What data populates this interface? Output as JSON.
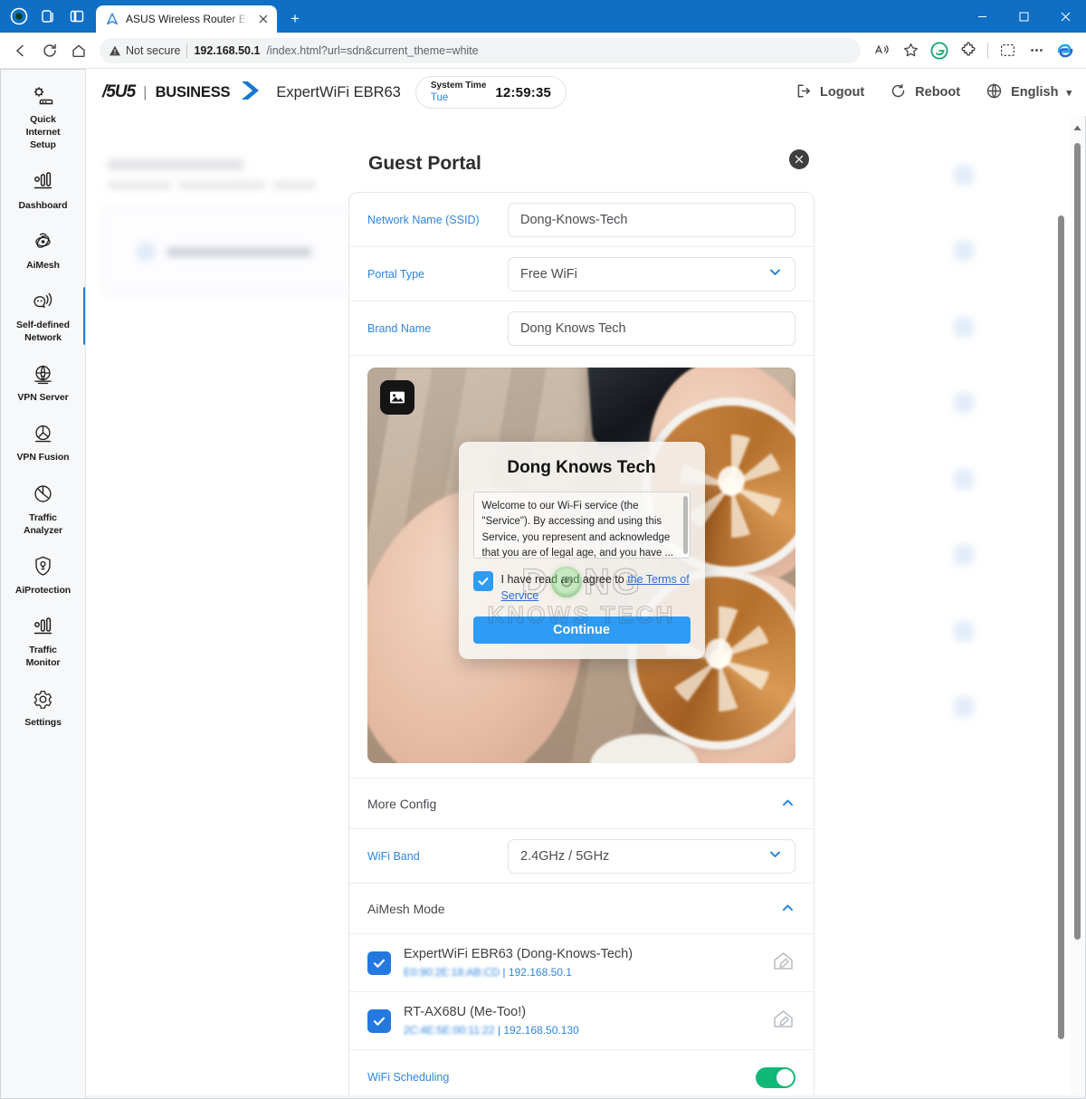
{
  "browser": {
    "window_buttons": [
      "minimize",
      "maximize",
      "close"
    ],
    "tab": {
      "title": "ASUS Wireless Router ExpertWiFi",
      "favicon": "asus-icon"
    },
    "new_tab_label": "+",
    "nav": {
      "back": "back-arrow",
      "reload": "reload-icon",
      "home": "home-icon"
    },
    "address": {
      "security_label": "Not secure",
      "host": "192.168.50.1",
      "path": "/index.html?url=sdn&current_theme=white"
    },
    "toolbar_icons": [
      "read-aloud-icon",
      "favorite-star-icon",
      "grammarly-icon",
      "extension-puzzle-icon",
      "screenshot-icon",
      "more-options-icon",
      "copilot-icon"
    ]
  },
  "app": {
    "brand": {
      "asus": "/5U5",
      "divider": "|",
      "business": "BUSINESS"
    },
    "model": "ExpertWiFi EBR63",
    "system_time": {
      "label": "System Time",
      "day": "Tue",
      "time": "12:59:35"
    },
    "header_actions": [
      {
        "label": "Logout",
        "icon": "logout-icon"
      },
      {
        "label": "Reboot",
        "icon": "reboot-icon"
      },
      {
        "label": "English",
        "icon": "globe-icon",
        "caret": "▾"
      }
    ],
    "sidebar": [
      {
        "label": "Quick\nInternet\nSetup",
        "icon": "quick-setup-icon",
        "active": false
      },
      {
        "label": "Dashboard",
        "icon": "dashboard-icon",
        "active": false
      },
      {
        "label": "AiMesh",
        "icon": "aimesh-icon",
        "active": false
      },
      {
        "label": "Self-defined\nNetwork",
        "icon": "self-defined-network-icon",
        "active": true
      },
      {
        "label": "VPN Server",
        "icon": "vpn-server-icon",
        "active": false
      },
      {
        "label": "VPN Fusion",
        "icon": "vpn-fusion-icon",
        "active": false
      },
      {
        "label": "Traffic\nAnalyzer",
        "icon": "traffic-analyzer-icon",
        "active": false
      },
      {
        "label": "AiProtection",
        "icon": "aiprotection-icon",
        "active": false
      },
      {
        "label": "Traffic\nMonitor",
        "icon": "traffic-monitor-icon",
        "active": false
      },
      {
        "label": "Settings",
        "icon": "settings-icon",
        "active": false
      }
    ]
  },
  "modal": {
    "title": "Guest Portal",
    "close_icon": "close-icon",
    "fields": {
      "ssid": {
        "label": "Network Name (SSID)",
        "value": "Dong-Knows-Tech"
      },
      "portal_type": {
        "label": "Portal Type",
        "value": "Free WiFi"
      },
      "brand_name": {
        "label": "Brand Name",
        "value": "Dong Knows Tech"
      }
    },
    "preview": {
      "upload_icon": "image-upload-icon",
      "portal_brand": "Dong Knows Tech",
      "terms_text": "Welcome to our Wi-Fi service (the \"Service\"). By accessing and using this Service, you represent and acknowledge that you are of legal age, and you have ...",
      "agree_prefix": "I have read and agree to ",
      "agree_link": "the Terms of Service",
      "continue_label": "Continue",
      "watermark_line1": "DONG",
      "watermark_line2": "KNOWS TECH"
    },
    "more_config": {
      "label": "More Config",
      "chevron": "chevron-up-icon"
    },
    "wifi_band": {
      "label": "WiFi Band",
      "value": "2.4GHz / 5GHz"
    },
    "aimesh_mode": {
      "label": "AiMesh Mode",
      "chevron": "chevron-up-icon"
    },
    "aimesh_nodes": [
      {
        "name": "ExpertWiFi EBR63 (Dong-Knows-Tech)",
        "mac": "E0:90:2E:18:AB:CD",
        "ip": "192.168.50.1",
        "checked": true,
        "edit_icon": "edit-node-icon"
      },
      {
        "name": "RT-AX68U (Me-Too!)",
        "mac": "2C:4E:5E:00:11:22",
        "ip": "192.168.50.130",
        "checked": true,
        "edit_icon": "edit-node-icon"
      }
    ],
    "wifi_scheduling": {
      "label": "WiFi Scheduling",
      "enabled": true
    }
  },
  "colors": {
    "accent_blue": "#2f86de",
    "link_blue": "#2479e0",
    "toggle_green": "#11b877",
    "browser_blue": "#0e6fc4"
  }
}
